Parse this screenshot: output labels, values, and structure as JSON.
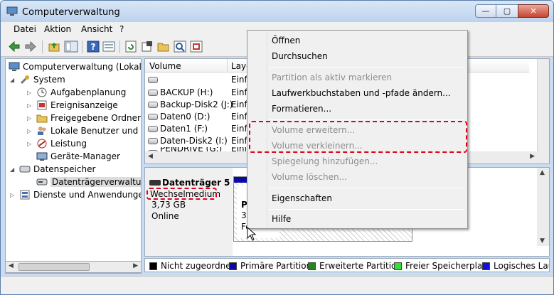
{
  "window": {
    "title": "Computerverwaltung",
    "buttons": {
      "minimize": "—",
      "maximize": "▢",
      "close": "✕"
    }
  },
  "menubar": [
    "Datei",
    "Aktion",
    "Ansicht",
    "?"
  ],
  "toolbar_icons": [
    "back-arrow-icon",
    "forward-arrow-icon",
    "up-folder-icon",
    "show-hide-tree-icon",
    "help-icon",
    "properties-pane-icon",
    "refresh-icon",
    "properties-icon",
    "open-folder-icon",
    "search-icon",
    "export-icon"
  ],
  "tree": {
    "root": "Computerverwaltung (Lokal)",
    "system": "System",
    "system_items": [
      "Aufgabenplanung",
      "Ereignisanzeige",
      "Freigegebene Ordner",
      "Lokale Benutzer und Gru",
      "Leistung",
      "Geräte-Manager"
    ],
    "storage": "Datenspeicher",
    "storage_items": [
      "Datenträgerverwaltung"
    ],
    "services": "Dienste und Anwendungen"
  },
  "volume_list": {
    "headers": [
      "Volume",
      "Layo"
    ],
    "rows": [
      {
        "name": "",
        "layout": "Einfa"
      },
      {
        "name": "BACKUP (H:)",
        "layout": "Einfa"
      },
      {
        "name": "Backup-Disk2 (J:)",
        "layout": "Einfa"
      },
      {
        "name": "Daten0 (D:)",
        "layout": "Einfa"
      },
      {
        "name": "Daten1 (F:)",
        "layout": "Einfa"
      },
      {
        "name": "Daten-Disk2 (I:)",
        "layout": "Einfa"
      },
      {
        "name": "PENDRIVE (G:)",
        "layout": "Einfa"
      }
    ]
  },
  "disk": {
    "title": "Datenträger 5",
    "type": "Wechselmedium",
    "size": "3,73 GB",
    "status": "Online",
    "partition_lines": [
      "PE",
      "3,7",
      "Fe"
    ]
  },
  "legend": [
    {
      "label": "Nicht zugeordnet",
      "color": "#000000"
    },
    {
      "label": "Primäre Partition",
      "color": "#0a0aa0"
    },
    {
      "label": "Erweiterte Partition",
      "color": "#1e8a1e"
    },
    {
      "label": "Freier Speicherplatz",
      "color": "#33e033"
    },
    {
      "label": "Logisches Lauf",
      "color": "#1010e0"
    }
  ],
  "context_menu": {
    "items": [
      {
        "label": "Öffnen",
        "enabled": true
      },
      {
        "label": "Durchsuchen",
        "enabled": true
      },
      {
        "label": "Partition als aktiv markieren",
        "enabled": false
      },
      {
        "label": "Laufwerkbuchstaben und -pfade ändern...",
        "enabled": true
      },
      {
        "label": "Formatieren...",
        "enabled": true
      },
      {
        "label": "Volume erweitern...",
        "enabled": false
      },
      {
        "label": "Volume verkleinern...",
        "enabled": false
      },
      {
        "label": "Spiegelung hinzufügen...",
        "enabled": false
      },
      {
        "label": "Volume löschen...",
        "enabled": false
      },
      {
        "label": "Eigenschaften",
        "enabled": true
      },
      {
        "label": "Hilfe",
        "enabled": true
      }
    ]
  },
  "colors": {
    "highlight": "#e0001b",
    "title_bar": "#c9dcf1"
  }
}
